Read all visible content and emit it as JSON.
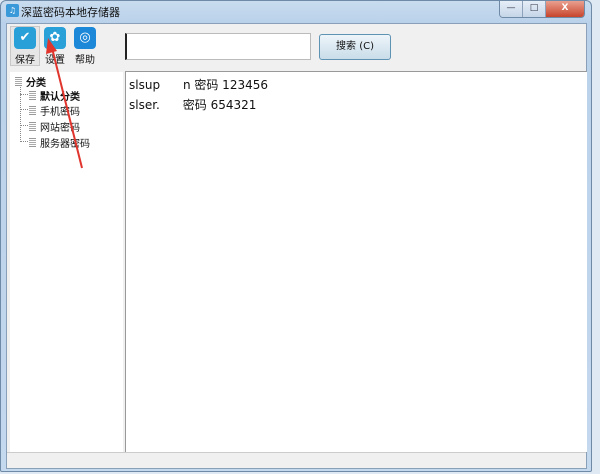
{
  "window": {
    "title": "深蓝密码本地存储器",
    "minimize": "—",
    "maximize": "□",
    "close": "X"
  },
  "toolbar": [
    {
      "label": "保存",
      "icon": "check-icon",
      "glyph": "✔",
      "color": "#2aa0d8"
    },
    {
      "label": "设置",
      "icon": "gear-icon",
      "glyph": "✿",
      "color": "#2aa0d8"
    },
    {
      "label": "帮助",
      "icon": "help-bubble-icon",
      "glyph": "◎",
      "color": "#1e88d8"
    }
  ],
  "search": {
    "value": "",
    "button_label": "搜索 (C)"
  },
  "tree": {
    "root": "分类",
    "items": [
      "默认分类",
      "手机密码",
      "网站密码",
      "服务器密码"
    ]
  },
  "list": [
    "slsup      n 密码 123456",
    "slser.      密码 654321"
  ]
}
